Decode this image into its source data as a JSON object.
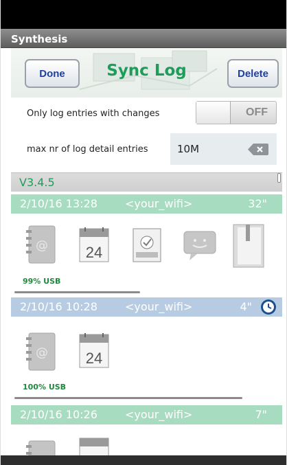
{
  "app": {
    "title": "Synthesis"
  },
  "header": {
    "title": "Sync Log",
    "done_label": "Done",
    "delete_label": "Delete"
  },
  "settings": {
    "only_changes_label": "Only log entries with changes",
    "only_changes_value": "OFF",
    "max_entries_label": "max nr of log detail entries",
    "max_entries_value": "10M"
  },
  "version": "V3.4.5",
  "entries": [
    {
      "datetime": "2/10/16  13:28",
      "network": "<your_wifi>",
      "duration": "32\"",
      "status": "99% USB",
      "icons": [
        "contacts-icon",
        "calendar-icon",
        "tasks-icon",
        "sms-icon",
        "notes-icon"
      ]
    },
    {
      "datetime": "2/10/16  10:28",
      "network": "<your_wifi>",
      "duration": "4\"",
      "status": "100% USB",
      "icons": [
        "contacts-icon",
        "calendar-icon"
      ]
    },
    {
      "datetime": "2/10/16  10:26",
      "network": "<your_wifi>",
      "duration": "7\"",
      "icons": [
        "contacts-icon",
        "calendar-icon"
      ]
    }
  ],
  "calendar_day": "24",
  "colors": {
    "accent_green": "#1f9b5a",
    "entry_green": "#a8dcc0",
    "entry_blue": "#b7cce3",
    "button_text": "#1d3fa0"
  }
}
